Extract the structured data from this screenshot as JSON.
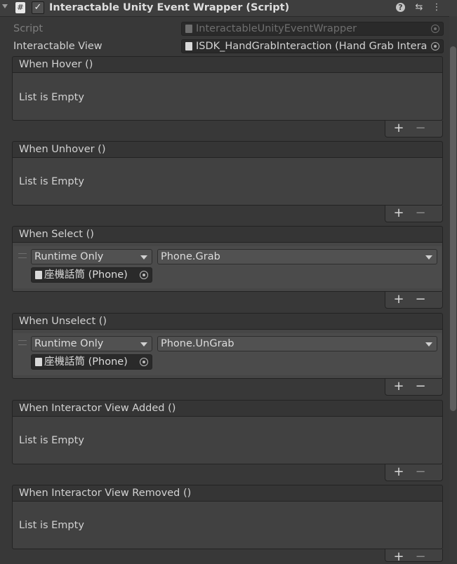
{
  "header": {
    "title": "Interactable Unity Event Wrapper (Script)",
    "script_icon_glyph": "#",
    "check_glyph": "✓",
    "help_glyph": "?",
    "settings_glyph": "⇆",
    "menu_glyph": "⋮"
  },
  "fields": {
    "script_label": "Script",
    "script_value": "InteractableUnityEventWrapper",
    "view_label": "Interactable View",
    "view_value": "ISDK_HandGrabInteraction (Hand Grab Interac"
  },
  "events": [
    {
      "title": "When Hover ()",
      "empty_text": "List is Empty"
    },
    {
      "title": "When Unhover ()",
      "empty_text": "List is Empty"
    },
    {
      "title": "When Select ()",
      "mode": "Runtime Only",
      "function": "Phone.Grab",
      "target": "座機話筒 (Phone)"
    },
    {
      "title": "When Unselect ()",
      "mode": "Runtime Only",
      "function": "Phone.UnGrab",
      "target": "座機話筒 (Phone)"
    },
    {
      "title": "When Interactor View Added ()",
      "empty_text": "List is Empty"
    },
    {
      "title": "When Interactor View Removed ()",
      "empty_text": "List is Empty"
    }
  ],
  "footer": {
    "plus": "+",
    "minus": "−"
  },
  "icons": [
    "foldout-arrow-icon",
    "script-icon",
    "checkbox-icon",
    "help-icon",
    "presets-icon",
    "menu-icon",
    "object-picker-icon",
    "dropdown-arrow-icon",
    "drag-handle-icon"
  ],
  "colors": {
    "background": "#383838",
    "header": "#3e3e3e",
    "field": "#2a2a2a",
    "text": "#d2d2d2",
    "disabled_text": "#7d7d7d"
  }
}
